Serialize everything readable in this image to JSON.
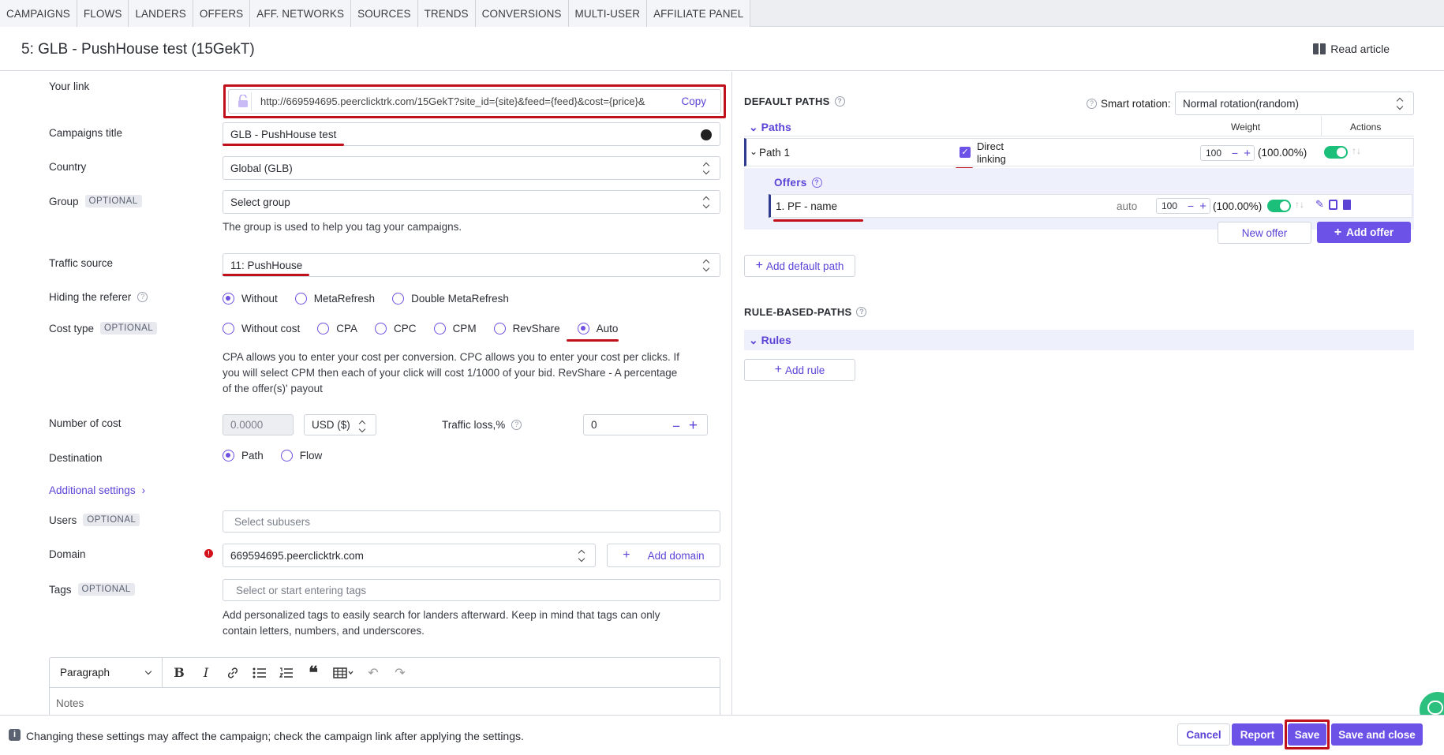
{
  "nav": {
    "tabs": [
      "CAMPAIGNS",
      "FLOWS",
      "LANDERS",
      "OFFERS",
      "AFF. NETWORKS",
      "SOURCES",
      "TRENDS",
      "CONVERSIONS",
      "MULTI-USER",
      "AFFILIATE PANEL"
    ]
  },
  "header": {
    "title": "5: GLB - PushHouse test (15GekT)",
    "read_article": "Read article"
  },
  "form": {
    "your_link": {
      "label": "Your link",
      "value": "http://669594695.peerclicktrk.com/15GekT?site_id={site}&feed={feed}&cost={price}&",
      "copy": "Copy"
    },
    "campaign_title": {
      "label": "Campaigns title",
      "value": "GLB - PushHouse test"
    },
    "country": {
      "label": "Country",
      "value": "Global (GLB)"
    },
    "group": {
      "label": "Group",
      "optional": "OPTIONAL",
      "placeholder": "Select group",
      "hint": "The group is used to help you tag your campaigns."
    },
    "traffic_source": {
      "label": "Traffic source",
      "value": "11: PushHouse"
    },
    "hiding_referer": {
      "label": "Hiding the referer",
      "options": [
        "Without",
        "MetaRefresh",
        "Double MetaRefresh"
      ],
      "selected": "Without"
    },
    "cost_type": {
      "label": "Cost type",
      "optional": "OPTIONAL",
      "options": [
        "Without cost",
        "CPA",
        "CPC",
        "CPM",
        "RevShare",
        "Auto"
      ],
      "selected": "Auto",
      "hint_1": "CPA allows you to enter your cost per conversion. CPC allows you to enter your cost per clicks. If",
      "hint_2": "you will select CPM then each of your click will cost 1/1000 of your bid. RevShare - A percentage",
      "hint_3": "of the offer(s)' payout"
    },
    "number_of_cost": {
      "label": "Number of cost",
      "placeholder": "0.0000",
      "currency": "USD ($)"
    },
    "traffic_loss": {
      "label": "Traffic loss,%",
      "value": "0"
    },
    "destination": {
      "label": "Destination",
      "options": [
        "Path",
        "Flow"
      ],
      "selected": "Path"
    },
    "additional_settings": "Additional settings",
    "users": {
      "label": "Users",
      "optional": "OPTIONAL",
      "placeholder": "Select subusers"
    },
    "domain": {
      "label": "Domain",
      "value": "669594695.peerclicktrk.com",
      "add_domain": "Add domain"
    },
    "tags": {
      "label": "Tags",
      "optional": "OPTIONAL",
      "placeholder": "Select or start entering tags",
      "hint_1": "Add personalized tags to easily search for landers afterward. Keep in mind that tags can only",
      "hint_2": "contain letters, numbers, and underscores."
    },
    "editor": {
      "format": "Paragraph",
      "placeholder": "Notes"
    }
  },
  "paths": {
    "default_title": "DEFAULT PATHS",
    "smart_rotation_label": "Smart rotation:",
    "smart_rotation_value": "Normal rotation(random)",
    "paths_label": "Paths",
    "weight_header": "Weight",
    "actions_header": "Actions",
    "path1": {
      "name": "Path 1",
      "direct_1": "Direct",
      "direct_2": "linking",
      "weight": "100",
      "percent": "(100.00%)"
    },
    "offers_label": "Offers",
    "offer1": {
      "name": "1. PF - name",
      "auto": "auto",
      "weight": "100",
      "percent": "(100.00%)"
    },
    "new_offer": "New offer",
    "add_offer": "Add offer",
    "add_default_path": "Add default path",
    "rule_title": "RULE-BASED-PATHS",
    "rules_label": "Rules",
    "add_rule": "Add rule"
  },
  "footer": {
    "notice": "Changing these settings may affect the campaign; check the campaign link after applying the settings.",
    "cancel": "Cancel",
    "report": "Report",
    "save": "Save",
    "save_close": "Save and close"
  },
  "colors": {
    "accent": "#6c52e6",
    "highlight": "#c0101c",
    "toggle": "#1bbf7a"
  }
}
